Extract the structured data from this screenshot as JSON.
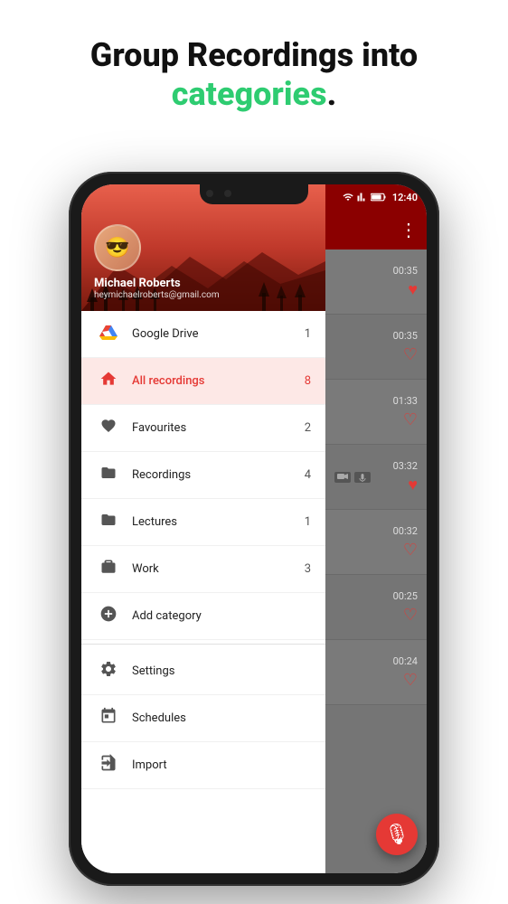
{
  "header": {
    "line1": "Group Recordings into",
    "line2_green": "categories",
    "line2_dot": "."
  },
  "status_bar": {
    "time": "12:40"
  },
  "drawer": {
    "user": {
      "name": "Michael Roberts",
      "email": "heymichaelroberts@gmail.com",
      "avatar_emoji": "😎"
    },
    "items": [
      {
        "id": "google-drive",
        "icon": "drive",
        "label": "Google Drive",
        "count": "1",
        "active": false
      },
      {
        "id": "all-recordings",
        "icon": "home",
        "label": "All recordings",
        "count": "8",
        "active": true
      },
      {
        "id": "favourites",
        "icon": "heart",
        "label": "Favourites",
        "count": "2",
        "active": false
      },
      {
        "id": "recordings",
        "icon": "folder",
        "label": "Recordings",
        "count": "4",
        "active": false
      },
      {
        "id": "lectures",
        "icon": "folder",
        "label": "Lectures",
        "count": "1",
        "active": false
      },
      {
        "id": "work",
        "icon": "briefcase",
        "label": "Work",
        "count": "3",
        "active": false
      },
      {
        "id": "add-category",
        "icon": "plus-circle",
        "label": "Add category",
        "count": "",
        "active": false
      }
    ],
    "bottom_items": [
      {
        "id": "settings",
        "icon": "gear",
        "label": "Settings"
      },
      {
        "id": "schedules",
        "icon": "calendar",
        "label": "Schedules"
      },
      {
        "id": "import",
        "icon": "import",
        "label": "Import"
      }
    ]
  },
  "recordings": [
    {
      "duration": "00:35",
      "heart": "filled",
      "has_icons": false
    },
    {
      "duration": "00:35",
      "heart": "outline",
      "has_icons": false
    },
    {
      "duration": "01:33",
      "heart": "outline",
      "has_icons": false
    },
    {
      "duration": "03:32",
      "heart": "filled",
      "has_icons": true
    },
    {
      "duration": "00:32",
      "heart": "outline",
      "has_icons": false
    },
    {
      "duration": "00:25",
      "heart": "outline",
      "has_icons": false
    },
    {
      "duration": "00:24",
      "heart": "outline",
      "has_icons": false
    }
  ],
  "fab": {
    "icon": "mic"
  }
}
